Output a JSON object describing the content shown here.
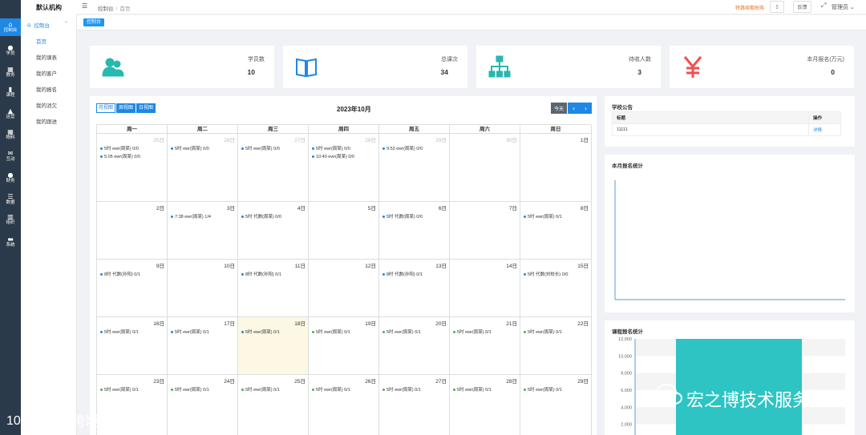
{
  "brand": {
    "name": "默认机构"
  },
  "iconbar": {
    "items": [
      {
        "icon": "home-icon",
        "glyph": "⌂",
        "label": "控制台",
        "active": true
      },
      {
        "icon": "user-icon",
        "glyph": "●",
        "label": "学员"
      },
      {
        "icon": "calendar-icon",
        "glyph": "▦",
        "label": "教务"
      },
      {
        "icon": "book-icon",
        "glyph": "▮",
        "label": "课程"
      },
      {
        "icon": "bag-icon",
        "glyph": "▲",
        "label": "运营"
      },
      {
        "icon": "grid-icon",
        "glyph": "▦",
        "label": "物料"
      },
      {
        "icon": "mail-icon",
        "glyph": "✉",
        "label": "互动"
      },
      {
        "icon": "person-icon",
        "glyph": "●",
        "label": "财务"
      },
      {
        "icon": "database-icon",
        "glyph": "☰",
        "label": "数据"
      },
      {
        "icon": "building-icon",
        "glyph": "▥",
        "label": "组织"
      },
      {
        "icon": "monitor-icon",
        "glyph": "▬",
        "label": "系统"
      }
    ]
  },
  "submenu": {
    "head": "控制台",
    "items": [
      {
        "label": "首页",
        "active": true
      },
      {
        "label": "我的课表"
      },
      {
        "label": "我的客户"
      },
      {
        "label": "我的报名"
      },
      {
        "label": "我的消欠"
      },
      {
        "label": "我的跟进"
      }
    ]
  },
  "breadcrumb": {
    "root": "控制台",
    "sep": "/",
    "current": "首页"
  },
  "topbar": {
    "warning": "特惠续期抢购",
    "btn1": "▯",
    "btn2": "反馈",
    "admin": "管理员 ⌄"
  },
  "tag": "控制台",
  "stats": [
    {
      "label": "学员数",
      "value": "10",
      "icon": "students-icon",
      "color": "#26b9ad"
    },
    {
      "label": "总课次",
      "value": "34",
      "icon": "open-book-icon",
      "color": "#1e88e5"
    },
    {
      "label": "待收人数",
      "value": "3",
      "icon": "org-chart-icon",
      "color": "#26b9ad"
    },
    {
      "label": "本月报名(万元)",
      "value": "0",
      "icon": "yen-icon",
      "color": "#f05050"
    }
  ],
  "calendar": {
    "views": [
      "月视图",
      "周视图",
      "日视图"
    ],
    "title": "2023年10月",
    "today": "今天",
    "prev": "‹",
    "next": "›",
    "weekdays": [
      "周一",
      "周二",
      "周三",
      "周四",
      "周五",
      "周六",
      "周日"
    ],
    "weeks": [
      [
        {
          "d": "25日",
          "other": true,
          "ev": [
            {
              "t": "5时 ewr(周某) 0/0",
              "c": "#1e88e5"
            },
            {
              "t": "5:05 ewr(周某) 0/0",
              "c": "#1e88e5"
            }
          ]
        },
        {
          "d": "26日",
          "other": true,
          "ev": [
            {
              "t": "5时 ewr(周某) 0/0",
              "c": "#1e88e5"
            }
          ]
        },
        {
          "d": "27日",
          "other": true,
          "ev": [
            {
              "t": "5时 ewr(周某) 0/0",
              "c": "#1e88e5"
            }
          ]
        },
        {
          "d": "28日",
          "other": true,
          "ev": [
            {
              "t": "5时 ewr(周某) 0/0",
              "c": "#1e88e5"
            },
            {
              "t": "10:40 ewr(周某) 0/0",
              "c": "#1e88e5"
            }
          ]
        },
        {
          "d": "29日",
          "other": true,
          "ev": [
            {
              "t": "9:53 ewr(周某) 0/0",
              "c": "#1e88e5"
            }
          ]
        },
        {
          "d": "30日",
          "other": true,
          "ev": []
        },
        {
          "d": "1日",
          "ev": []
        }
      ],
      [
        {
          "d": "2日",
          "ev": []
        },
        {
          "d": "3日",
          "ev": [
            {
              "t": "7:38 ewr(周某) 1/4",
              "c": "#1e88e5"
            }
          ]
        },
        {
          "d": "4日",
          "ev": [
            {
              "t": "5时 代数(周某) 0/0",
              "c": "#1e88e5"
            }
          ]
        },
        {
          "d": "5日",
          "ev": []
        },
        {
          "d": "6日",
          "ev": [
            {
              "t": "5时 代数(周某) 0/0",
              "c": "#1e88e5"
            }
          ]
        },
        {
          "d": "7日",
          "ev": []
        },
        {
          "d": "8日",
          "ev": [
            {
              "t": "5时 ewr(周某) 0/1",
              "c": "#1e88e5"
            }
          ]
        }
      ],
      [
        {
          "d": "9日",
          "ev": [
            {
              "t": "8时 代数(孙阳) 0/1",
              "c": "#1e88e5"
            }
          ]
        },
        {
          "d": "10日",
          "ev": []
        },
        {
          "d": "11日",
          "ev": [
            {
              "t": "8时 代数(孙阳) 0/1",
              "c": "#1e88e5"
            }
          ]
        },
        {
          "d": "12日",
          "ev": []
        },
        {
          "d": "13日",
          "ev": [
            {
              "t": "8时 代数(孙阳) 0/1",
              "c": "#1e88e5"
            }
          ]
        },
        {
          "d": "14日",
          "ev": []
        },
        {
          "d": "15日",
          "ev": [
            {
              "t": "5时 代数(刘校长) 0/0",
              "c": "#1e88e5"
            }
          ]
        }
      ],
      [
        {
          "d": "16日",
          "ev": [
            {
              "t": "5时 ewr(周某) 0/1",
              "c": "#1e88e5"
            }
          ]
        },
        {
          "d": "17日",
          "ev": [
            {
              "t": "5时 ewr(周某) 0/1",
              "c": "#1e88e5"
            }
          ]
        },
        {
          "d": "18日",
          "today": true,
          "ev": [
            {
              "t": "5时 ewr(周某) 0/1",
              "c": "#1e88e5"
            }
          ]
        },
        {
          "d": "19日",
          "ev": [
            {
              "t": "5时 ewr(周某) 0/1",
              "c": "#4caf50"
            }
          ]
        },
        {
          "d": "20日",
          "ev": [
            {
              "t": "5时 ewr(周某) 0/1",
              "c": "#4caf50"
            }
          ]
        },
        {
          "d": "21日",
          "ev": [
            {
              "t": "5时 ewr(周某) 0/1",
              "c": "#4caf50"
            }
          ]
        },
        {
          "d": "22日",
          "ev": [
            {
              "t": "5时 ewr(周某) 0/1",
              "c": "#4caf50"
            }
          ]
        }
      ],
      [
        {
          "d": "23日",
          "ev": [
            {
              "t": "5时 ewr(周某) 0/1",
              "c": "#4caf50"
            }
          ]
        },
        {
          "d": "24日",
          "ev": [
            {
              "t": "5时 ewr(周某) 0/1",
              "c": "#4caf50"
            }
          ]
        },
        {
          "d": "25日",
          "ev": [
            {
              "t": "5时 ewr(周某) 0/1",
              "c": "#4caf50"
            }
          ]
        },
        {
          "d": "26日",
          "ev": [
            {
              "t": "5时 ewr(周某) 0/1",
              "c": "#4caf50"
            }
          ]
        },
        {
          "d": "27日",
          "ev": [
            {
              "t": "5时 ewr(周某) 0/1",
              "c": "#4caf50"
            }
          ]
        },
        {
          "d": "28日",
          "ev": [
            {
              "t": "5时 ewr(周某) 0/1",
              "c": "#4caf50"
            }
          ]
        },
        {
          "d": "29日",
          "ev": [
            {
              "t": "5时 ewr(周某) 0/1",
              "c": "#4caf50"
            }
          ]
        }
      ]
    ]
  },
  "notice": {
    "title": "学校公告",
    "col_title": "标题",
    "col_action": "操作",
    "rows": [
      {
        "title": "11111",
        "action": "详情"
      }
    ]
  },
  "monthly": {
    "title": "本月报名统计"
  },
  "course": {
    "title": "课程报名统计"
  },
  "watermarks": {
    "left": "大数跨境",
    "right": "宏之博技术服务"
  },
  "chart_data": [
    {
      "type": "line",
      "title": "本月报名统计"
    },
    {
      "type": "bar",
      "title": "课程报名统计",
      "yticks": [
        "12,000",
        "10,000",
        "8,000",
        "6,000",
        "4,000",
        "2,000"
      ],
      "ylim": [
        0,
        12000
      ],
      "values": [
        12000
      ]
    }
  ]
}
